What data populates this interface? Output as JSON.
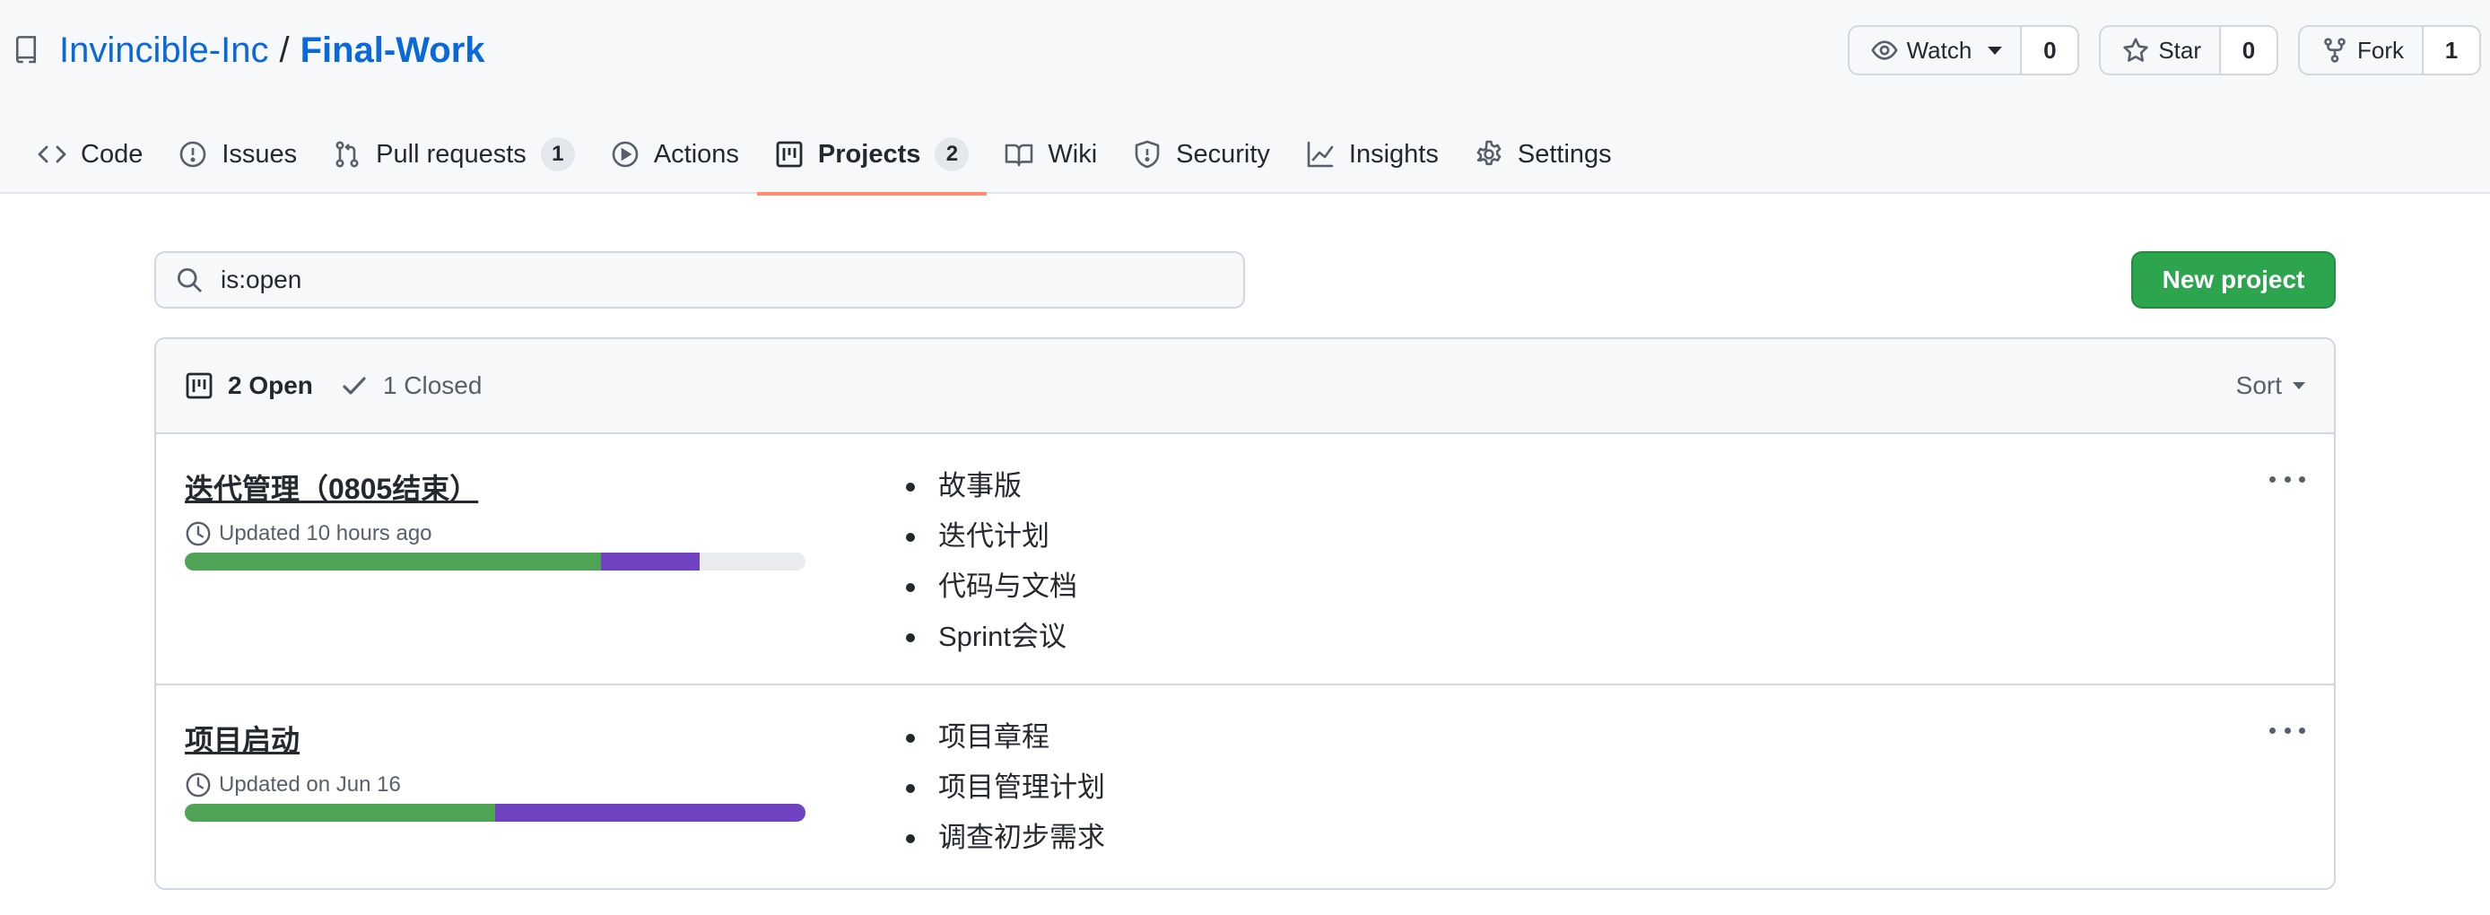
{
  "repo": {
    "owner": "Invincible-Inc",
    "separator": "/",
    "name": "Final-Work"
  },
  "actions": {
    "watch": {
      "label": "Watch",
      "count": "0"
    },
    "star": {
      "label": "Star",
      "count": "0"
    },
    "fork": {
      "label": "Fork",
      "count": "1"
    }
  },
  "tabs": [
    {
      "label": "Code",
      "icon": "code-icon"
    },
    {
      "label": "Issues",
      "icon": "issue-icon"
    },
    {
      "label": "Pull requests",
      "icon": "pull-request-icon",
      "counter": "1"
    },
    {
      "label": "Actions",
      "icon": "play-icon"
    },
    {
      "label": "Projects",
      "icon": "project-icon",
      "counter": "2",
      "selected": true
    },
    {
      "label": "Wiki",
      "icon": "book-icon"
    },
    {
      "label": "Security",
      "icon": "shield-icon"
    },
    {
      "label": "Insights",
      "icon": "graph-icon"
    },
    {
      "label": "Settings",
      "icon": "gear-icon"
    }
  ],
  "toolbar": {
    "search_value": "is:open",
    "new_project_label": "New project"
  },
  "filters": {
    "open_label": "2 Open",
    "closed_label": "1 Closed",
    "sort_label": "Sort"
  },
  "projects": [
    {
      "name": "迭代管理（0805结束）",
      "updated": "Updated 10 hours ago",
      "progress": {
        "done_percent": 67,
        "in_progress_percent": 16
      },
      "columns": [
        "故事版",
        "迭代计划",
        "代码与文档",
        "Sprint会议"
      ]
    },
    {
      "name": "项目启动",
      "updated": "Updated on Jun 16",
      "progress": {
        "done_percent": 50,
        "in_progress_percent": 50
      },
      "columns": [
        "项目章程",
        "项目管理计划",
        "调查初步需求"
      ]
    }
  ],
  "colors": {
    "link": "#0969da",
    "primary_button": "#2da44e",
    "progress_done": "#4ea354",
    "progress_in_progress": "#6f42c1",
    "tab_underline": "#fd8c73"
  }
}
